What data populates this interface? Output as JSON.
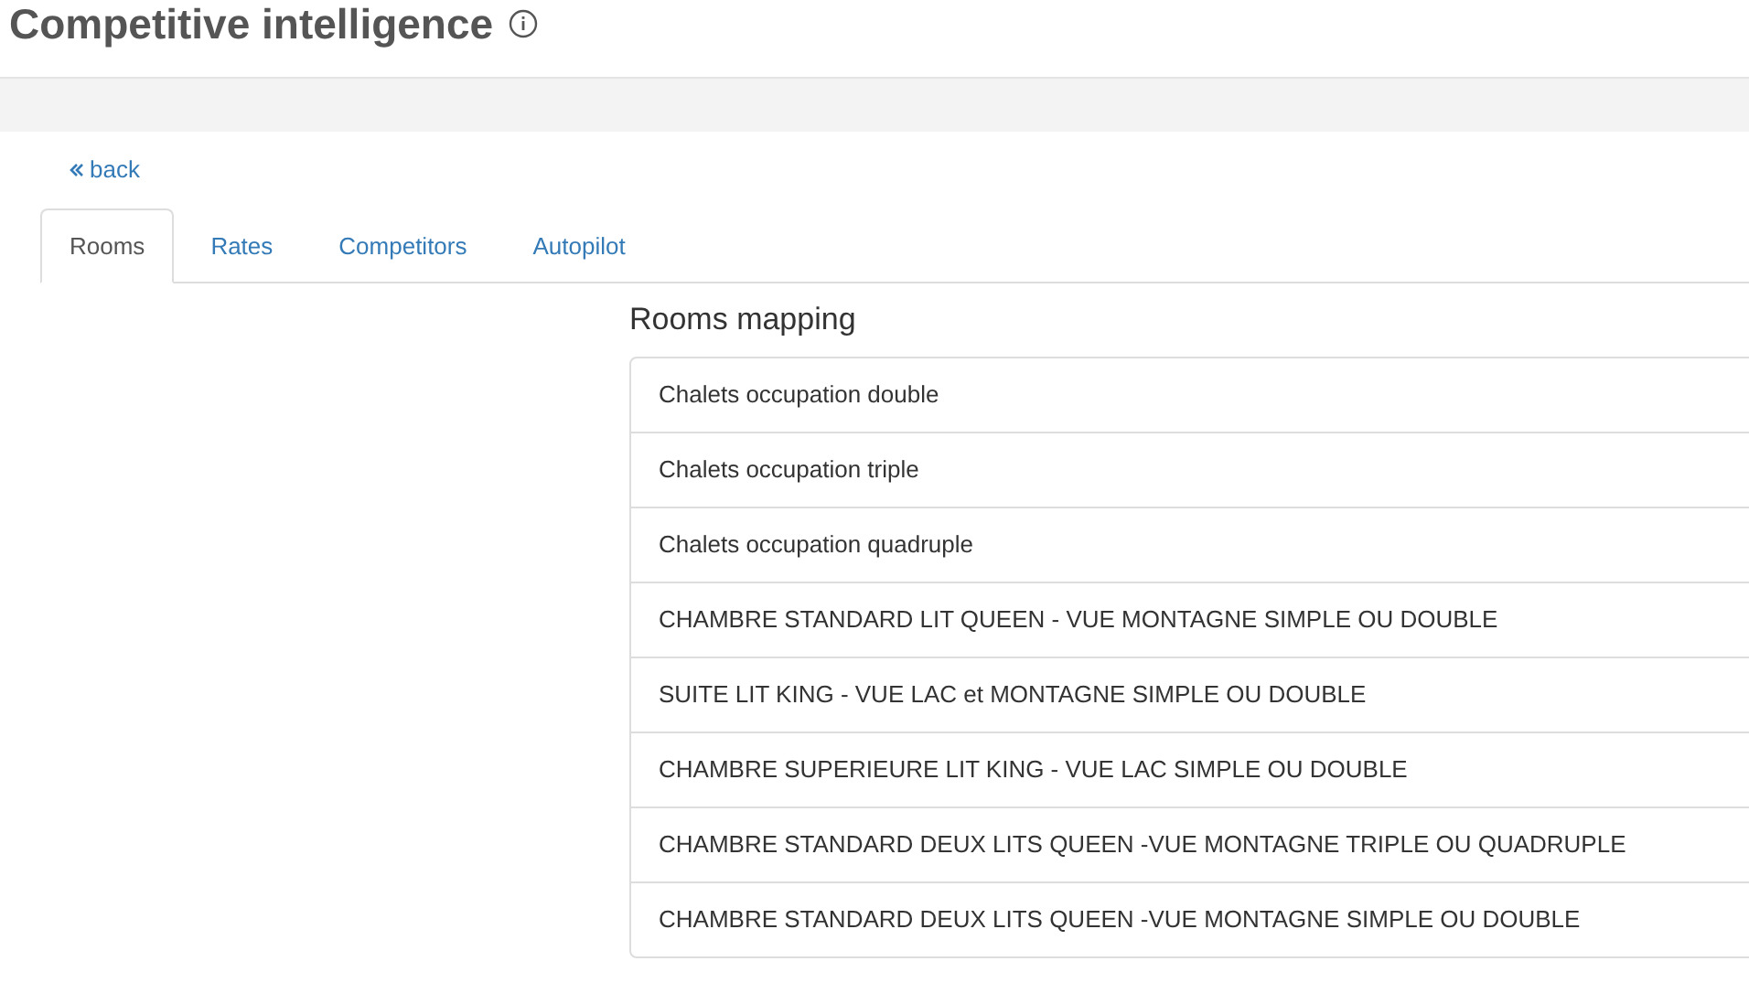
{
  "page": {
    "title": "Competitive intelligence"
  },
  "back_link": "back",
  "tabs": [
    {
      "label": "Rooms",
      "selected": true
    },
    {
      "label": "Rates",
      "selected": false
    },
    {
      "label": "Competitors",
      "selected": false
    },
    {
      "label": "Autopilot",
      "selected": false
    }
  ],
  "rooms_mapping": {
    "heading": "Rooms mapping",
    "rooms": [
      "Chalets occupation double",
      "Chalets occupation triple",
      "Chalets occupation quadruple",
      "CHAMBRE STANDARD LIT QUEEN - VUE MONTAGNE SIMPLE OU DOUBLE",
      "SUITE LIT KING - VUE LAC et MONTAGNE SIMPLE OU DOUBLE",
      "CHAMBRE SUPERIEURE LIT KING - VUE LAC SIMPLE OU DOUBLE",
      "CHAMBRE STANDARD DEUX LITS QUEEN -VUE MONTAGNE TRIPLE OU QUADRUPLE",
      "CHAMBRE STANDARD DEUX LITS QUEEN -VUE MONTAGNE SIMPLE OU DOUBLE"
    ]
  }
}
